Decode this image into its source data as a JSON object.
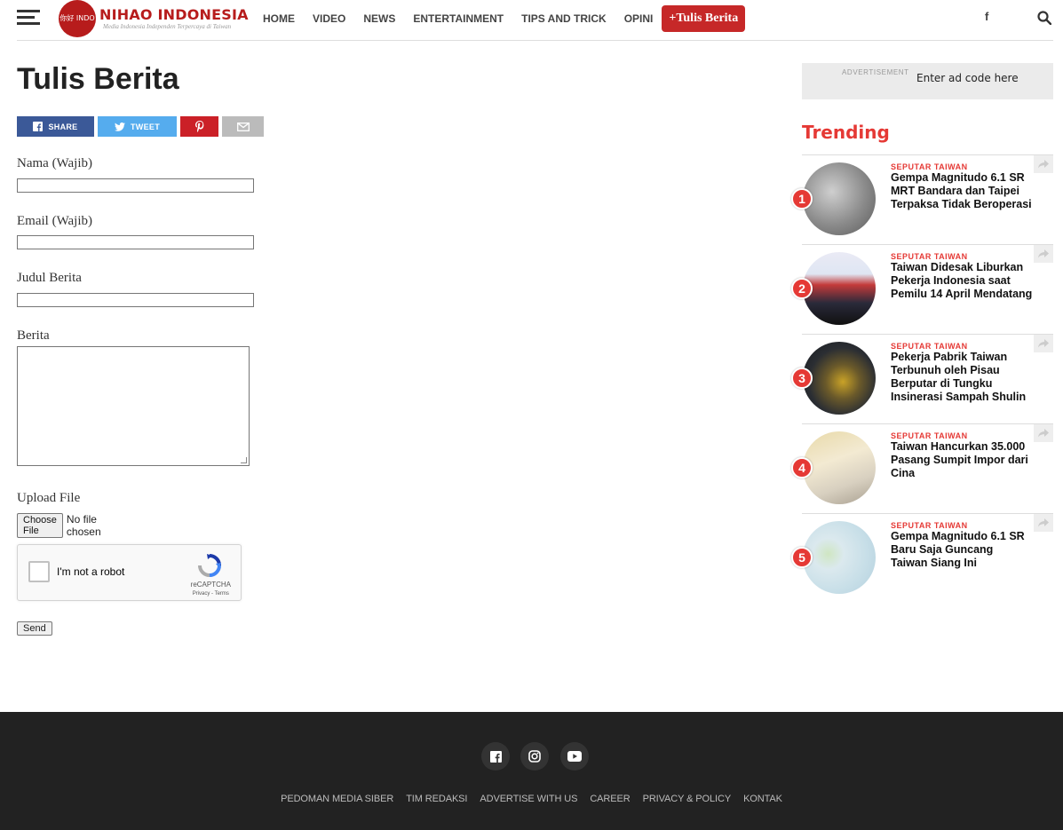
{
  "header": {
    "logo_circle_text": "你好 INDO",
    "logo_name": "NIHAO INDONESIA",
    "logo_tagline": "Media Indonesia Independen Terpercaya di Taiwan",
    "nav": [
      "HOME",
      "VIDEO",
      "NEWS",
      "ENTERTAINMENT",
      "TIPS AND TRICK",
      "OPINI"
    ],
    "cta_label": "+Tulis Berita",
    "facebook_glyph": "f"
  },
  "page": {
    "title": "Tulis Berita",
    "share": {
      "facebook": "SHARE",
      "twitter": "TWEET"
    }
  },
  "form": {
    "name_label": "Nama (Wajib)",
    "email_label": "Email (Wajib)",
    "title_label": "Judul Berita",
    "body_label": "Berita",
    "upload_label": "Upload File",
    "choose_file": "Choose File",
    "no_file": "No file chosen",
    "captcha_text": "I'm not a robot",
    "captcha_brand": "reCAPTCHA",
    "captcha_links": "Privacy - Terms",
    "send": "Send"
  },
  "sidebar": {
    "ad_label": "ADVERTISEMENT",
    "ad_text": "Enter ad code here",
    "trending_title": "Trending",
    "items": [
      {
        "rank": "1",
        "category": "SEPUTAR TAIWAN",
        "title": "Gempa Magnitudo 6.1 SR MRT Bandara dan Taipei Terpaksa Tidak Beroperasi"
      },
      {
        "rank": "2",
        "category": "SEPUTAR TAIWAN",
        "title": "Taiwan Didesak Liburkan Pekerja Indonesia saat Pemilu 14 April Mendatang"
      },
      {
        "rank": "3",
        "category": "SEPUTAR TAIWAN",
        "title": "Pekerja Pabrik Taiwan Terbunuh oleh Pisau Berputar di Tungku Insinerasi Sampah Shulin"
      },
      {
        "rank": "4",
        "category": "SEPUTAR TAIWAN",
        "title": "Taiwan Hancurkan 35.000 Pasang Sumpit Impor dari Cina"
      },
      {
        "rank": "5",
        "category": "SEPUTAR TAIWAN",
        "title": "Gempa Magnitudo 6.1 SR Baru Saja Guncang Taiwan Siang Ini"
      }
    ]
  },
  "footer": {
    "links": [
      "PEDOMAN MEDIA SIBER",
      "TIM REDAKSI",
      "ADVERTISE WITH US",
      "CAREER",
      "PRIVACY & POLICY",
      "KONTAK"
    ]
  },
  "colors": {
    "brand_red": "#b71c1c",
    "accent_red": "#e53935",
    "cta_red": "#c62828",
    "facebook": "#3b5998",
    "twitter": "#55acee",
    "pinterest": "#cb2027",
    "footer_bg": "#222222"
  },
  "icons": [
    "hamburger-icon",
    "facebook-icon",
    "search-icon",
    "twitter-icon",
    "pinterest-icon",
    "mail-icon",
    "share-arrow-icon",
    "instagram-icon",
    "youtube-icon",
    "recaptcha-icon"
  ]
}
